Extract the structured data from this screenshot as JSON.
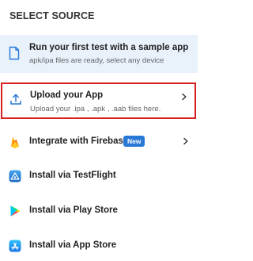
{
  "header": {
    "title": "SELECT SOURCE"
  },
  "sample": {
    "title": "Run your first test with a sample app",
    "subtitle": "apk/ipa files are ready, select any device"
  },
  "upload": {
    "title": "Upload your App",
    "subtitle": "Upload your .ipa , .apk , .aab files here."
  },
  "firebase": {
    "title": "Integrate with Firebase",
    "badge": "New"
  },
  "testflight": {
    "title": "Install via TestFlight"
  },
  "playstore": {
    "title": "Install via Play Store"
  },
  "appstore": {
    "title": "Install via App Store"
  },
  "colors": {
    "highlight_border": "#d62020",
    "sample_bg": "#e9f1fb",
    "accent_blue": "#2878d6"
  },
  "icons": {
    "sample": "document-icon",
    "upload": "upload-icon",
    "firebase": "firebase-icon",
    "testflight": "testflight-icon",
    "playstore": "play-store-icon",
    "appstore": "app-store-icon",
    "chevron": "chevron-right-icon"
  }
}
